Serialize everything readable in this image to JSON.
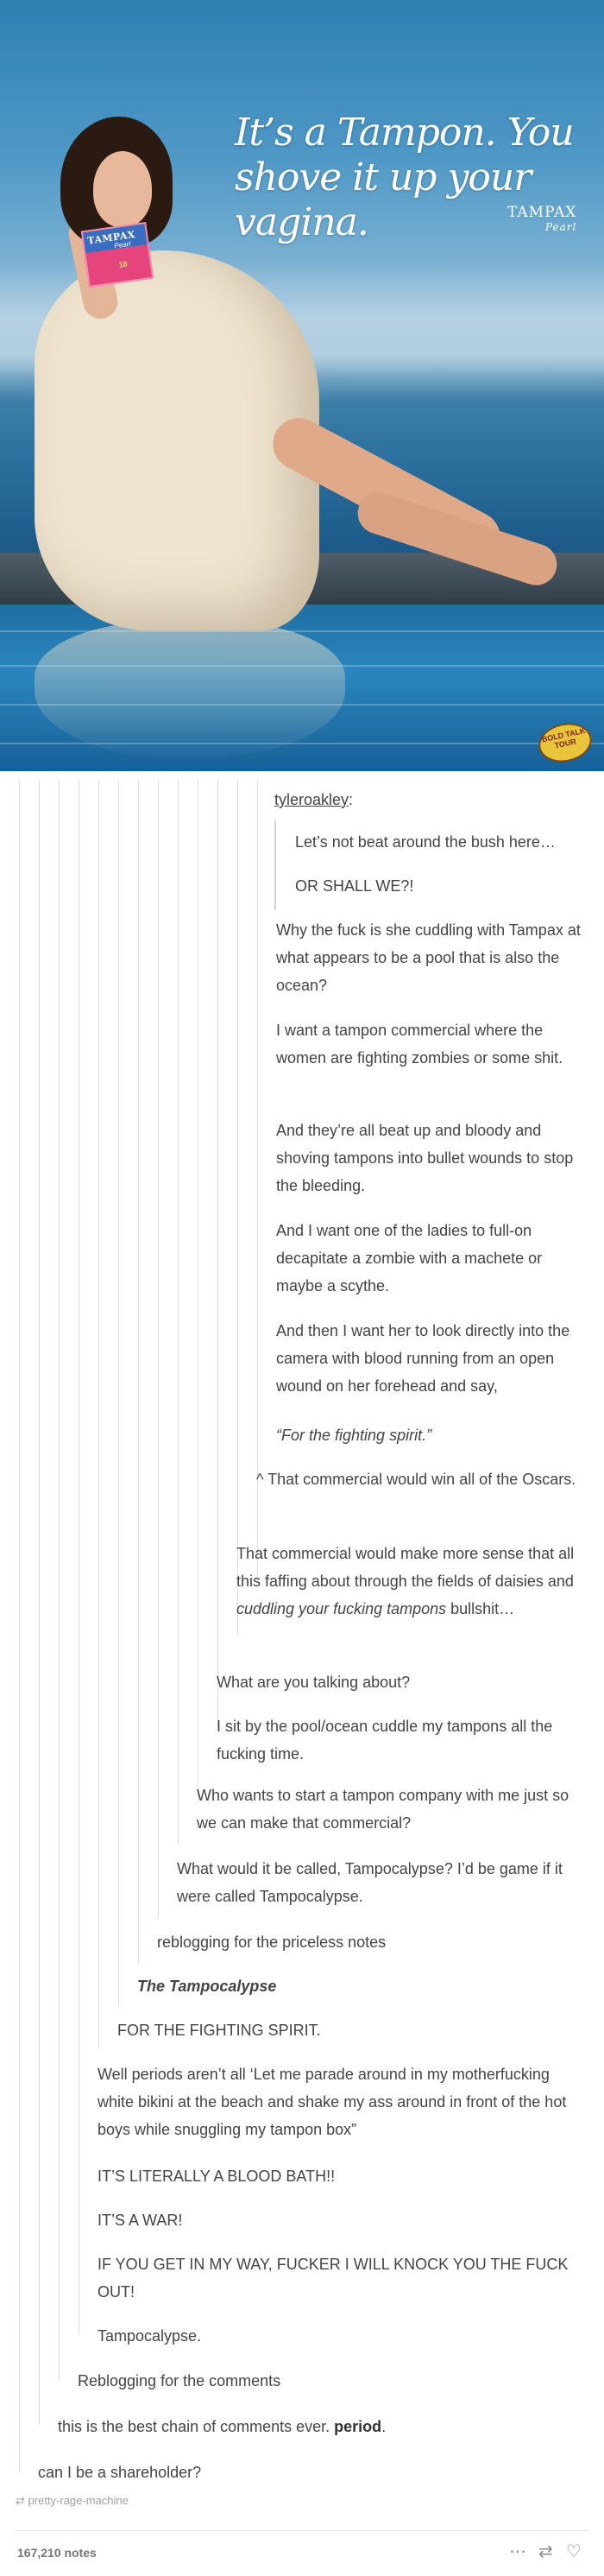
{
  "ad": {
    "headline": "It’s a Tampon. You shove it up your vagina.",
    "logo": "TAMPAX",
    "logo_sub": "Pearl",
    "box_brand": "TAMPAX",
    "box_sub": "Pearl",
    "box_count": "18",
    "badge": "BOLD TALK TOUR"
  },
  "post": {
    "username": "tyleroakley",
    "quoted": [
      "Let’s not beat around the bush here…",
      "OR SHALL WE?!"
    ],
    "paragraphs": [
      "Why the fuck is she cuddling with Tampax at what appears to be a pool that is also the ocean?",
      "I want a tampon commercial where the women are fighting zombies or some shit.",
      "And they’re all beat up and bloody and shoving tampons into bullet wounds to stop the bleeding.",
      "And I want one of the ladies to full-on decapitate a zombie with a machete or maybe a scythe.",
      "And then I want her to look directly into the camera with blood running from an open wound on her forehead and say,",
      "“For the fighting spirit.”"
    ],
    "replies": [
      "^ That commercial would win all of the Oscars.",
      "That commercial would make more sense that all this faffing about through the fields of daisies and",
      "cuddling your fucking tampons",
      "bullshit…",
      "What are you talking about?",
      "I sit by the pool/ocean cuddle my tampons all the fucking time.",
      "Who wants to start a tampon company with me just so we can make that commercial?",
      "What would it be called, Tampocalypse? I’d be game if it were called Tampocalypse.",
      "reblogging for the priceless notes",
      "The Tampocalypse",
      "FOR THE FIGHTING SPIRIT.",
      "Well periods aren’t all ‘Let me parade around in my motherfucking white bikini at the beach and shake my ass around in front of the hot boys while snuggling my tampon box”",
      "IT’S LITERALLY A BLOOD BATH!!",
      "IT’S A WAR!",
      "IF YOU GET IN MY WAY, FUCKER I WILL KNOCK YOU THE FUCK OUT!",
      "Tampocalypse.",
      "Reblogging for the comments",
      "this is the best chain of comments ever.",
      "period",
      "can I be a shareholder?"
    ]
  },
  "footer": {
    "source": "pretty-rage-machine",
    "notes": "167,210 notes",
    "icons": [
      "more-icon",
      "reblog-icon",
      "like-icon"
    ]
  },
  "colors": {
    "text": "#444444",
    "rule": "#dcdcdc"
  }
}
